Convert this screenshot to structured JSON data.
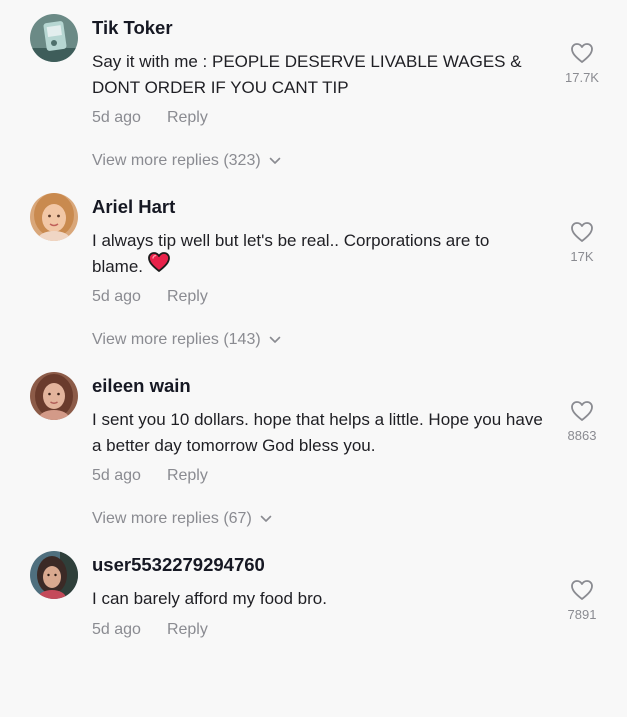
{
  "comments": [
    {
      "username": "Tik Toker",
      "text": "Say it with me : PEOPLE DESERVE LIVABLE WAGES & DONT ORDER IF YOU CANT TIP",
      "age": "5d ago",
      "reply_label": "Reply",
      "likes": "17.7K",
      "view_more": "View more replies (323)"
    },
    {
      "username": "Ariel Hart",
      "text": "I always tip well but let's be real.. Corporations are to blame.",
      "age": "5d ago",
      "reply_label": "Reply",
      "likes": "17K",
      "view_more": "View more replies (143)",
      "emoji": "heart-emoji"
    },
    {
      "username": "eileen wain",
      "text": "I sent you 10 dollars. hope that helps a little. Hope you have a better day tomorrow God bless you.",
      "age": "5d ago",
      "reply_label": "Reply",
      "likes": "8863",
      "view_more": "View more replies (67)"
    },
    {
      "username": "user5532279294760",
      "text": "I can barely afford my food bro.",
      "age": "5d ago",
      "reply_label": "Reply",
      "likes": "7891"
    }
  ],
  "icons": {
    "like": "heart-outline-icon",
    "expand": "chevron-down-icon"
  },
  "colors": {
    "background": "#f8f8f8",
    "secondary_text": "#8a8b91",
    "emoji_heart": "#e8224a"
  }
}
